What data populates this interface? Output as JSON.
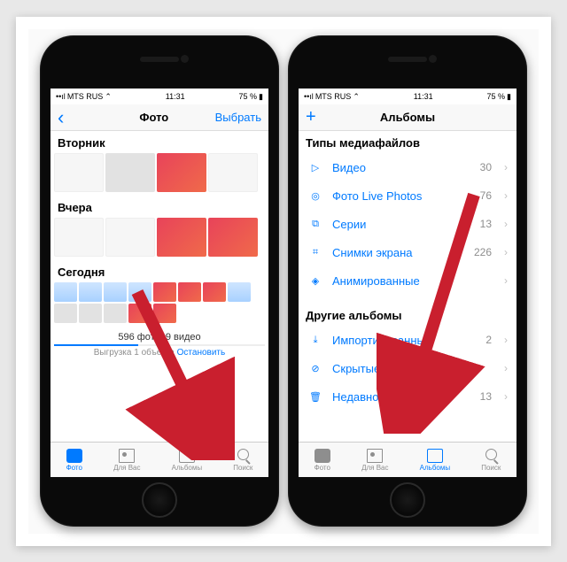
{
  "status": {
    "carrier": "MTS RUS",
    "time": "11:31",
    "battery": "75 %"
  },
  "left_phone": {
    "nav": {
      "back": "‹",
      "title": "Фото",
      "select": "Выбрать"
    },
    "sections": {
      "s1": "Вторник",
      "s2": "Вчера",
      "s3": "Сегодня"
    },
    "summary": "596 фото, 9 видео",
    "upload_prefix": "Выгрузка 1 объекта",
    "upload_stop": "Остановить",
    "tabs": {
      "t1": "Фото",
      "t2": "Для Вас",
      "t3": "Альбомы",
      "t4": "Поиск"
    }
  },
  "right_phone": {
    "nav": {
      "add": "+",
      "title": "Альбомы"
    },
    "section_types": "Типы медиафайлов",
    "types": [
      {
        "label": "Видео",
        "count": "30"
      },
      {
        "label": "Фото Live Photos",
        "count": "76"
      },
      {
        "label": "Серии",
        "count": "13"
      },
      {
        "label": "Снимки экрана",
        "count": "226"
      },
      {
        "label": "Анимированные",
        "count": ""
      }
    ],
    "section_other": "Другие альбомы",
    "other": [
      {
        "label": "Импортированные",
        "count": "2"
      },
      {
        "label": "Скрытые",
        "count": ""
      },
      {
        "label": "Недавно удаленные",
        "count": "13"
      }
    ],
    "tabs": {
      "t1": "Фото",
      "t2": "Для Вас",
      "t3": "Альбомы",
      "t4": "Поиск"
    }
  }
}
